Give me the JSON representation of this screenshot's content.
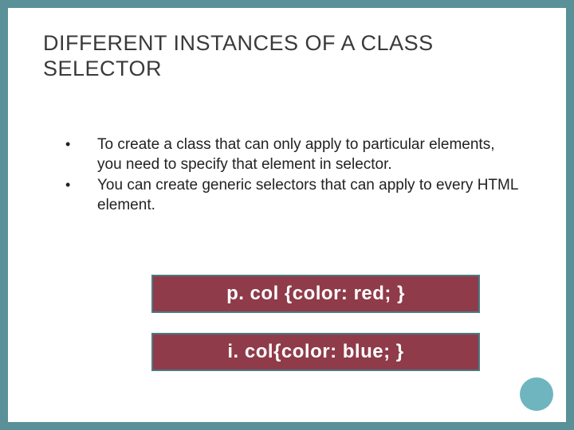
{
  "title": "DIFFERENT INSTANCES OF A CLASS SELECTOR",
  "bullets": [
    "To create a class that can only apply to particular elements, you need to specify that element in selector.",
    " You can create generic selectors that can apply to every HTML element."
  ],
  "code": {
    "line1": "p. col {color: red; }",
    "line2": "i. col{color: blue; }"
  }
}
